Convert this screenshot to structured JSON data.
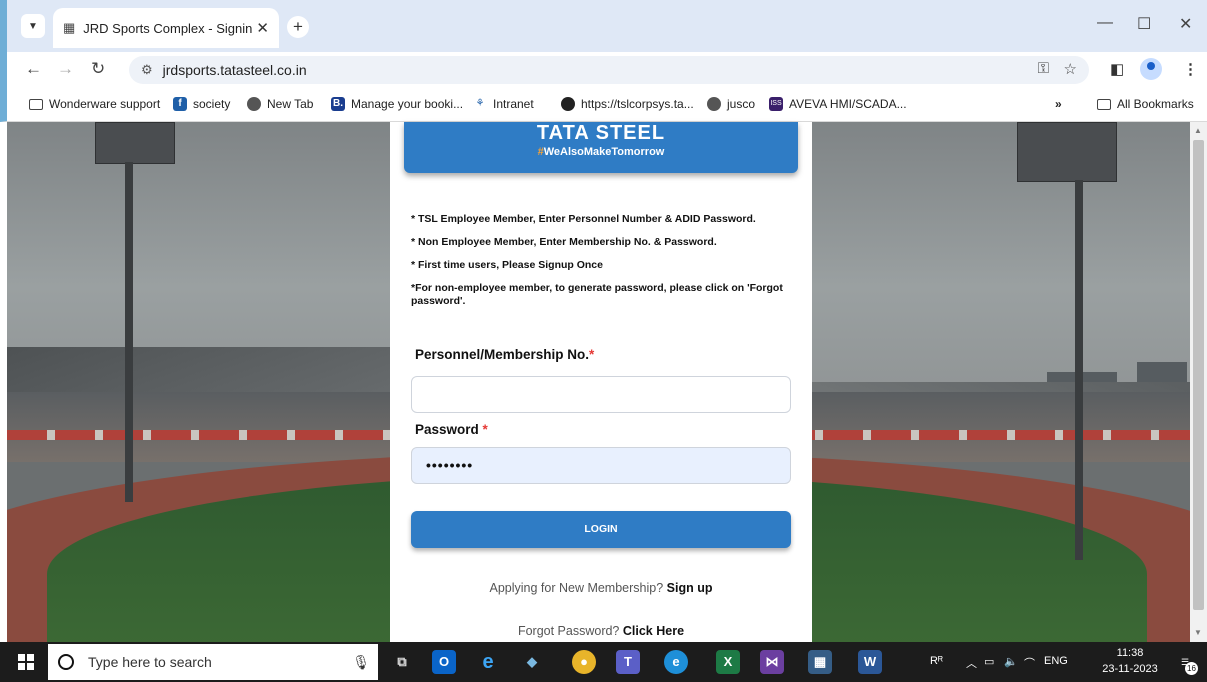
{
  "browser": {
    "tab_title": "JRD Sports Complex - Signin",
    "url": "jrdsports.tatasteel.co.in",
    "bookmarks": [
      {
        "label": "Wonderware support",
        "icon": "folder-icon"
      },
      {
        "label": "society",
        "icon": "facebook-icon"
      },
      {
        "label": "New Tab",
        "icon": "globe-icon"
      },
      {
        "label": "Manage your booki...",
        "icon": "booking-icon"
      },
      {
        "label": "Intranet",
        "icon": "tata-icon"
      },
      {
        "label": "https://tslcorpsys.ta...",
        "icon": "dark-globe-icon"
      },
      {
        "label": "jusco",
        "icon": "globe-icon"
      },
      {
        "label": "AVEVA HMI/SCADA...",
        "icon": "iss-icon"
      }
    ],
    "overflow_label": "»",
    "all_bookmarks": "All Bookmarks"
  },
  "card": {
    "logo_text": "TATA STEEL",
    "logo_tag_hash": "#",
    "logo_tag": "WeAlsoMakeTomorrow",
    "instructions": [
      "* TSL Employee Member, Enter Personnel Number & ADID Password.",
      "* Non Employee Member, Enter Membership No. & Password.",
      "* First time users, Please Signup Once",
      "*For non-employee member, to generate password, please click on 'Forgot password'."
    ],
    "membership_label": "Personnel/Membership No.",
    "membership_value": "",
    "password_label": "Password",
    "password_value": "••••••••",
    "required_mark": "*",
    "login_label": "LOGIN",
    "signup_prompt": "Applying for New Membership?",
    "signup_link": "Sign up",
    "forgot_prompt": "Forgot Password?",
    "forgot_link": "Click Here"
  },
  "taskbar": {
    "search_placeholder": "Type here to search",
    "lang": "ENG",
    "time": "11:38",
    "date": "23-11-2023",
    "notifications": "16"
  },
  "colors": {
    "accent": "#2f7cc5",
    "required": "#e53935",
    "taskbar": "#1c1c1c"
  }
}
